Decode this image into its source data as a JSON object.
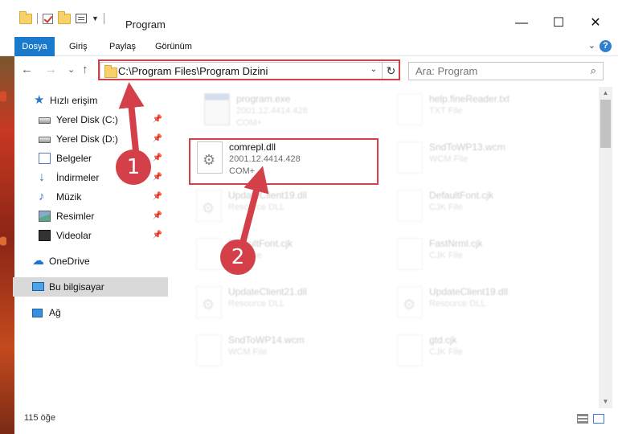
{
  "window": {
    "title": "Program",
    "minimize": "—",
    "maximize": "☐",
    "close": "✕"
  },
  "ribbon": {
    "tabs": [
      "Dosya",
      "Giriş",
      "Paylaş",
      "Görünüm"
    ],
    "help": "?"
  },
  "nav": {
    "back": "←",
    "forward": "→",
    "recent": "⌄",
    "up": "↑",
    "address": "C:\\Program Files\\Program Dizini",
    "refresh": "↻",
    "search_placeholder": "Ara: Program"
  },
  "sidebar": {
    "items": [
      {
        "label": "Hızlı erişim",
        "icon": "star-icon",
        "pinned": false
      },
      {
        "label": "Yerel Disk (C:)",
        "icon": "drive-icon",
        "pinned": true
      },
      {
        "label": "Yerel Disk (D:)",
        "icon": "drive-icon",
        "pinned": true
      },
      {
        "label": "Belgeler",
        "icon": "documents-icon",
        "pinned": true
      },
      {
        "label": "İndirmeler",
        "icon": "download-icon",
        "pinned": true
      },
      {
        "label": "Müzik",
        "icon": "music-icon",
        "pinned": true
      },
      {
        "label": "Resimler",
        "icon": "pictures-icon",
        "pinned": true
      },
      {
        "label": "Videolar",
        "icon": "videos-icon",
        "pinned": true
      },
      {
        "label": "OneDrive",
        "icon": "cloud-icon",
        "pinned": false
      },
      {
        "label": "Bu bilgisayar",
        "icon": "computer-icon",
        "pinned": false,
        "selected": true
      },
      {
        "label": "Ağ",
        "icon": "network-icon",
        "pinned": false
      }
    ],
    "pin_glyph": "📌"
  },
  "files": [
    {
      "name": "program.exe",
      "l1": "2001.12.4414.428",
      "l2": "COM+",
      "type": "exe"
    },
    {
      "name": "help.fineReader.txt",
      "l1": "TXT File",
      "l2": "",
      "type": "txt"
    },
    {
      "name": "comrepl.dll",
      "l1": "2001.12.4414.428",
      "l2": "COM+",
      "type": "dll"
    },
    {
      "name": "SndToWP13.wcm",
      "l1": "WCM File",
      "l2": "",
      "type": "txt"
    },
    {
      "name": "UpdateClient19.dll",
      "l1": "Resource DLL",
      "l2": "",
      "type": "dll"
    },
    {
      "name": "DefaultFont.cjk",
      "l1": "CJK File",
      "l2": "",
      "type": "txt"
    },
    {
      "name": "DefaultFont.cjk",
      "l1": "CJK File",
      "l2": "",
      "type": "txt"
    },
    {
      "name": "FastNrml.cjk",
      "l1": "CJK File",
      "l2": "",
      "type": "txt"
    },
    {
      "name": "UpdateClient21.dll",
      "l1": "Resource DLL",
      "l2": "",
      "type": "dll"
    },
    {
      "name": "UpdateClient19.dll",
      "l1": "Resource DLL",
      "l2": "",
      "type": "dll"
    },
    {
      "name": "SndToWP14.wcm",
      "l1": "WCM File",
      "l2": "",
      "type": "txt"
    },
    {
      "name": "gtd.cjk",
      "l1": "CJK File",
      "l2": "",
      "type": "txt"
    }
  ],
  "status": {
    "count": "115 öğe"
  },
  "markers": [
    "1",
    "2"
  ],
  "colors": {
    "accent": "#1979ca",
    "highlight": "#d3404a"
  }
}
